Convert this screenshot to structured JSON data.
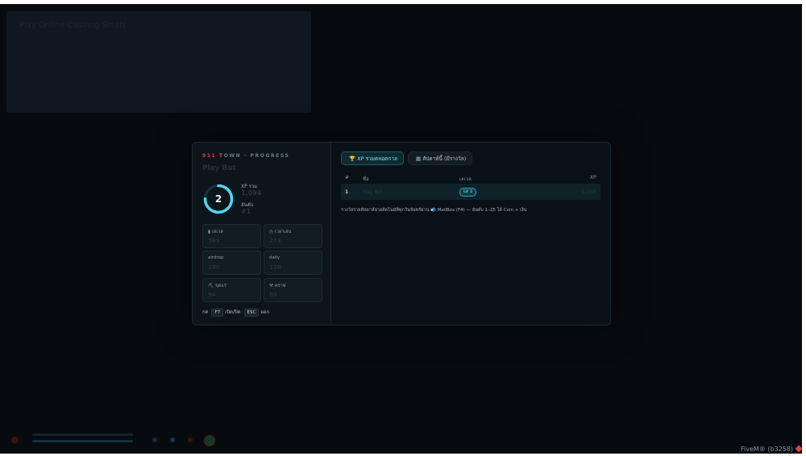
{
  "background_panel": {
    "title": "Play Online Casinog Sinals"
  },
  "progress": {
    "brand_number": "911",
    "brand_text": "TOWN · PROGRESS",
    "player_name": "Play Bot",
    "level": "2",
    "level_progress": 0.75,
    "xp_label": "XP รวม",
    "xp_value": "1,094",
    "rank_label": "อันดับ",
    "rank_value": "#1",
    "stats": [
      {
        "icon": "scroll-icon",
        "icon_glyph": "▮",
        "label": "เลเวล",
        "value": "365"
      },
      {
        "icon": "clock-icon",
        "icon_glyph": "◷",
        "label": "เวลาเล่น",
        "value": "273"
      },
      {
        "icon": "",
        "icon_glyph": "",
        "label": "airdrop",
        "value": "150"
      },
      {
        "icon": "",
        "icon_glyph": "",
        "label": "daily",
        "value": "120"
      },
      {
        "icon": "pickaxe-icon",
        "icon_glyph": "⛏",
        "label": "ขุดแร่",
        "value": "94"
      },
      {
        "icon": "hammer-icon",
        "icon_glyph": "⚒",
        "label": "คราฟ",
        "value": "80"
      }
    ],
    "hint": {
      "press": "กด",
      "key_toggle": "F7",
      "toggle_text": "เปิด/ปิด",
      "key_exit": "ESC",
      "exit_text": "ออก"
    }
  },
  "leaderboard": {
    "tabs": [
      {
        "icon": "trophy-icon",
        "label": "XP รวมตลอดกาล",
        "active": true
      },
      {
        "icon": "calendar-icon",
        "label": "สัปดาห์นี้ (มีรางวัล)",
        "active": false
      }
    ],
    "columns": [
      "#",
      "ชื่อ",
      "เลเวล",
      "XP"
    ],
    "rows": [
      {
        "rank": "1",
        "name": "Play Bot",
        "level": "LV 2",
        "xp": "1,094"
      }
    ],
    "note": "รางวัลรายสัปดาห์จ่ายอัตโนมัติทุกวันจันทร์ผ่าน 📬 MailBox (F4) — อันดับ 1–25 ได้ Coin + เงิน"
  },
  "footer": {
    "app_text": "FiveM® (b3258)"
  },
  "colors": {
    "accent": "#4fd8f0",
    "brand_red": "#e53845",
    "rank_gold": "#e7d25a"
  }
}
